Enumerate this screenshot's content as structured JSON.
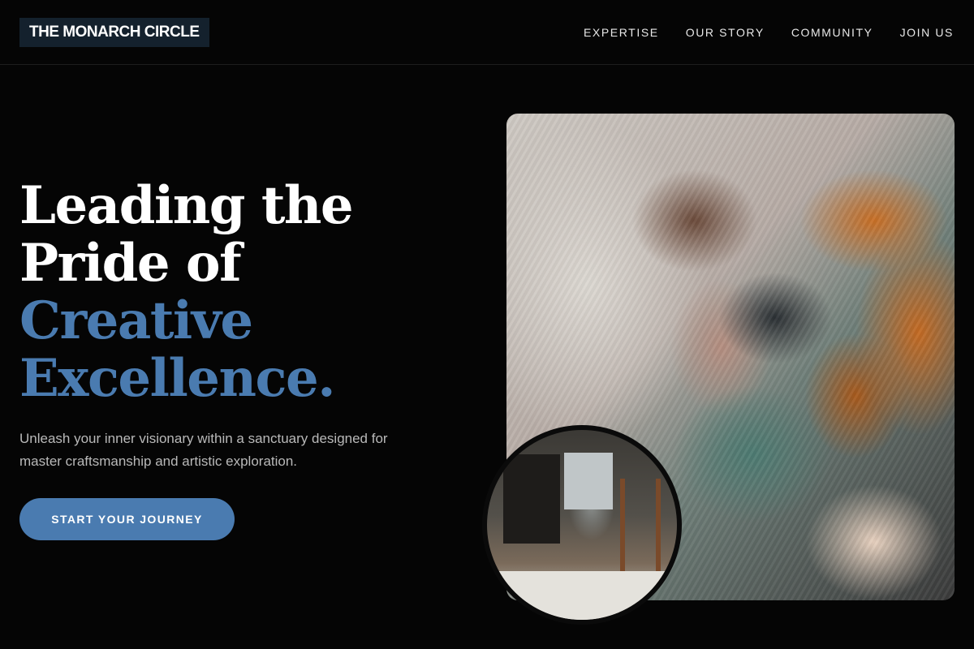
{
  "brand": {
    "logo": "THE MONARCH CIRCLE"
  },
  "nav": {
    "items": [
      {
        "label": "EXPERTISE"
      },
      {
        "label": "OUR STORY"
      },
      {
        "label": "COMMUNITY"
      },
      {
        "label": "JOIN US"
      }
    ]
  },
  "hero": {
    "title_lines": [
      "Leading the",
      "Pride of"
    ],
    "title_accent_lines": [
      "Creative",
      "Excellence."
    ],
    "subtitle": "Unleash your inner visionary within a sanctuary designed for master craftsmanship and artistic exploration.",
    "cta_label": "START YOUR JOURNEY"
  },
  "colors": {
    "accent": "#4a7bb0",
    "background": "#050505",
    "logo_bg": "#14212d"
  },
  "images": {
    "main": "abstract-oil-paint-texture",
    "inset": "artist-studio-interior"
  }
}
